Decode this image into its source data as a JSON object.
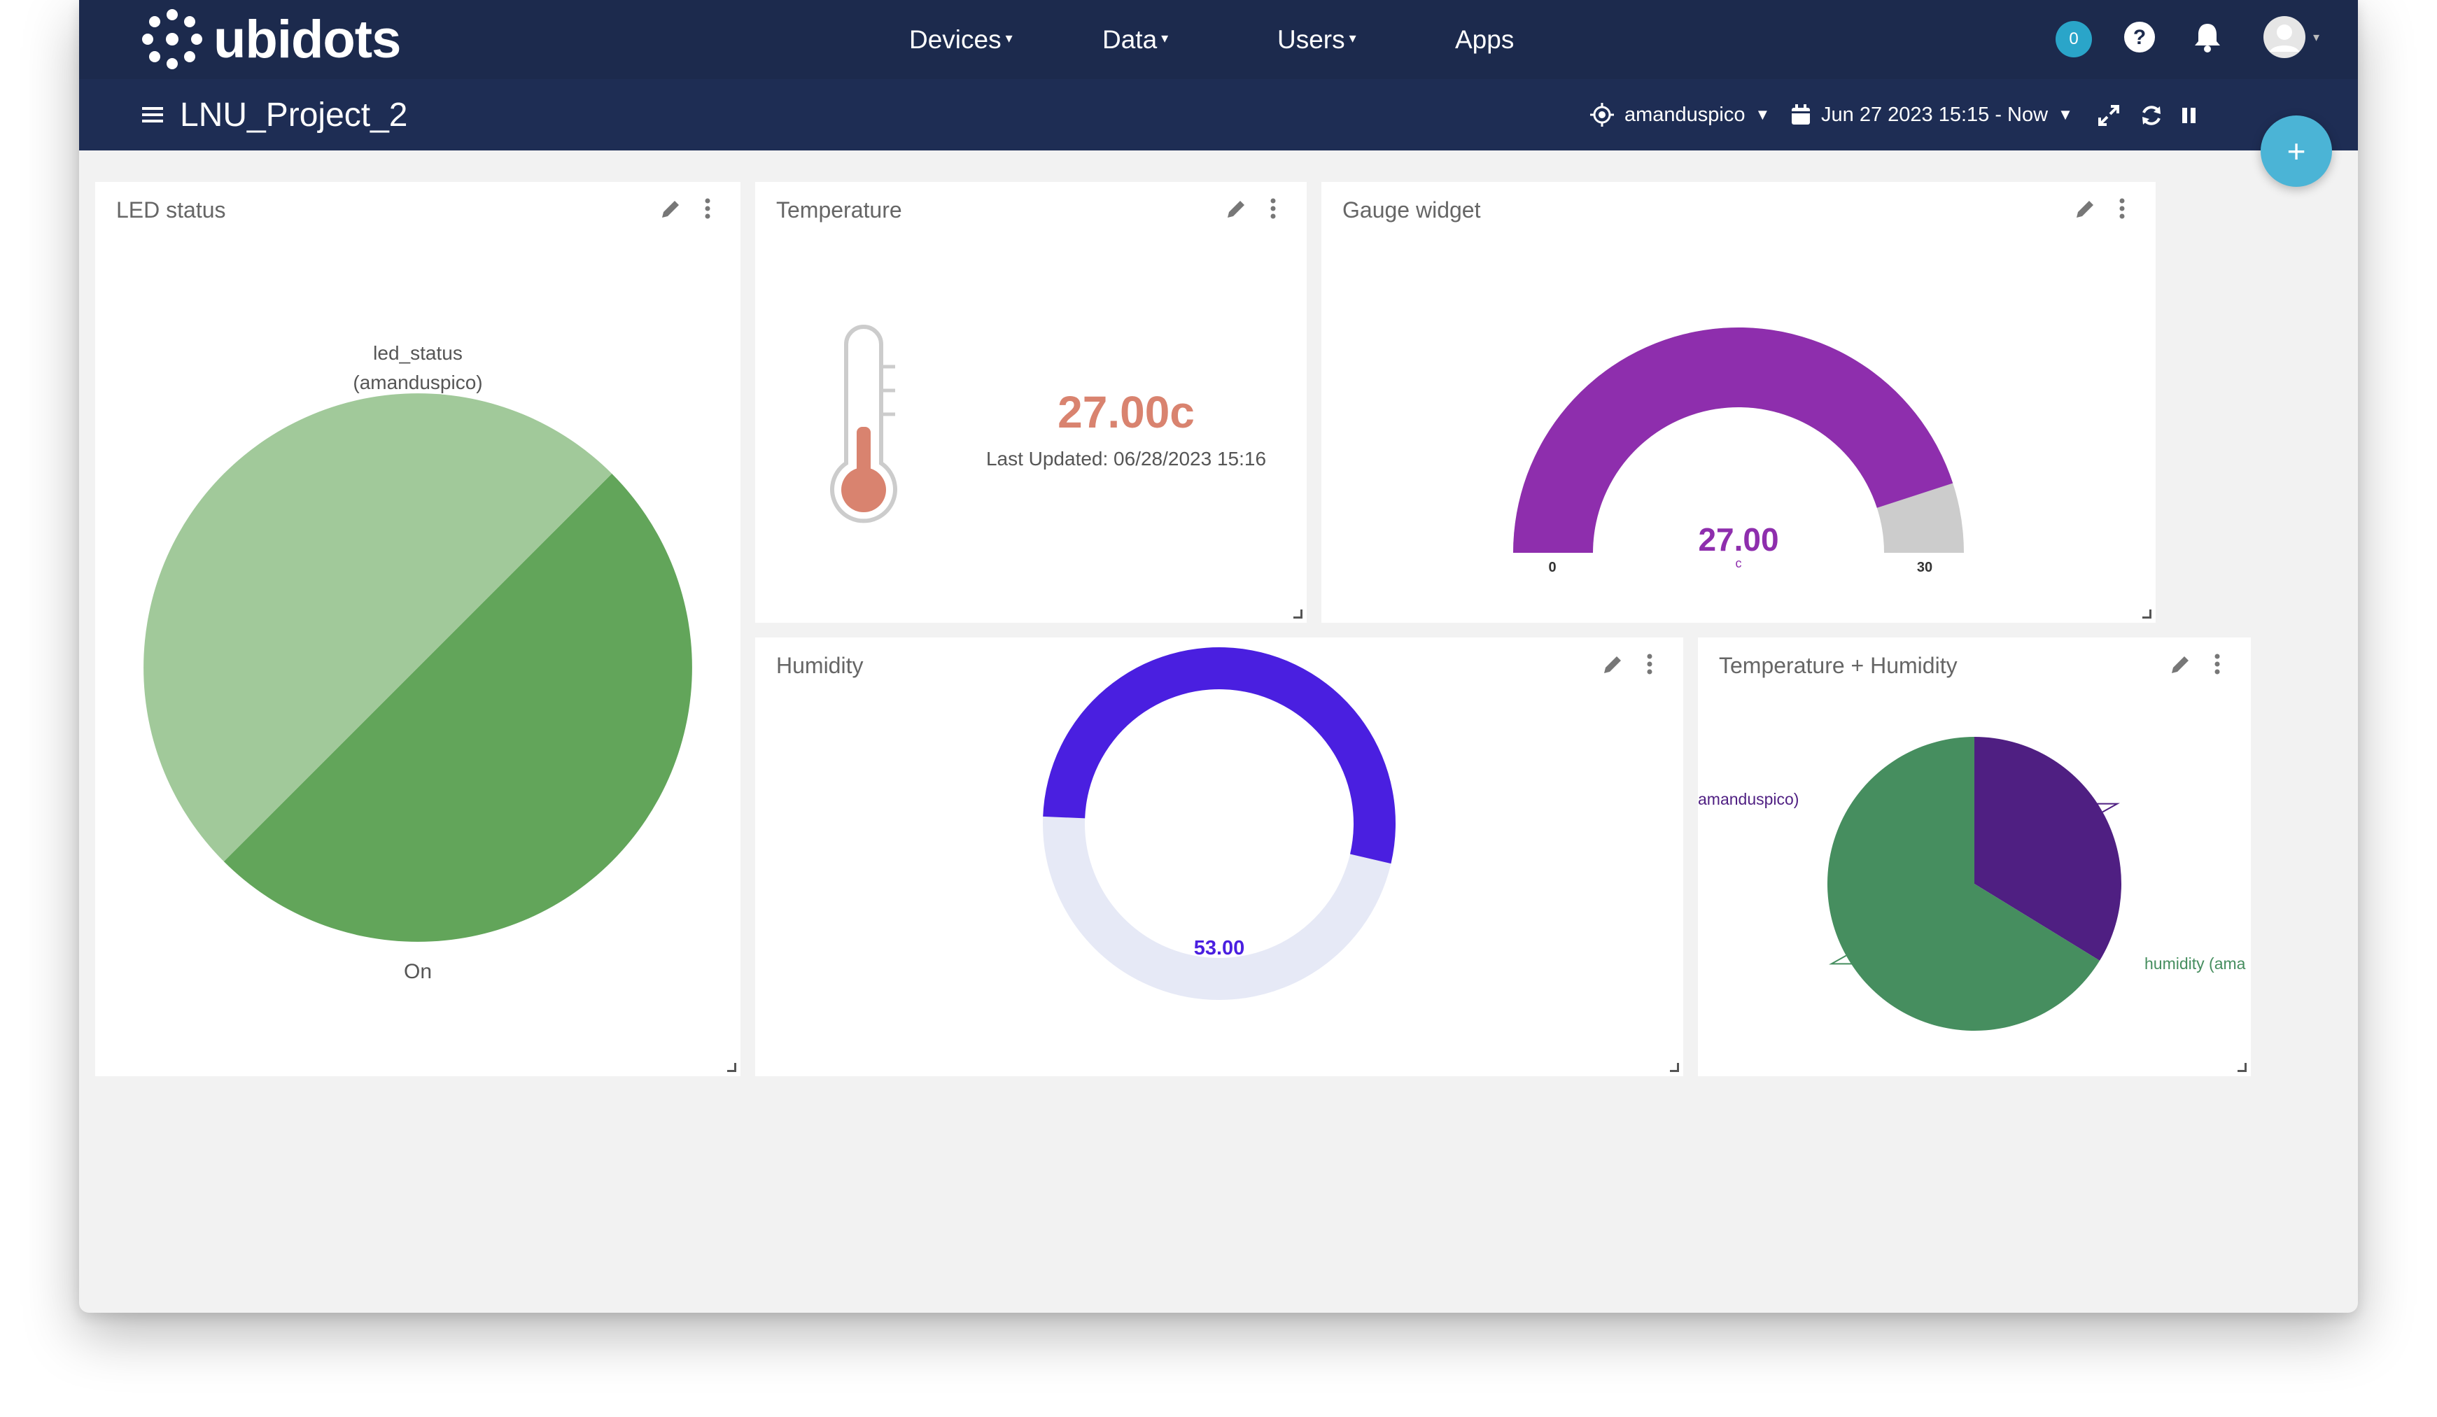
{
  "app": {
    "brand": "ubidots",
    "nav": [
      {
        "label": "Devices",
        "has_dropdown": true
      },
      {
        "label": "Data",
        "has_dropdown": true
      },
      {
        "label": "Users",
        "has_dropdown": true
      },
      {
        "label": "Apps",
        "has_dropdown": false
      }
    ],
    "notification_count": "0",
    "icons": {
      "help": "help-icon",
      "notifications": "bell-icon",
      "avatar": "user-avatar-icon"
    }
  },
  "dashboard": {
    "title": "LNU_Project_2",
    "device_filter": "amanduspico",
    "date_range": "Jun 27 2023 15:15 - Now",
    "add_button": "+"
  },
  "widgets": {
    "led": {
      "title": "LED status",
      "series_label_line1": "led_status",
      "series_label_line2": "(amanduspico)",
      "bottom_label": "On",
      "colors": [
        "#62a55a",
        "#a1c99a"
      ]
    },
    "temperature": {
      "title": "Temperature",
      "value": "27.00c",
      "last_updated": "Last Updated: 06/28/2023 15:16",
      "color": "#d9836f"
    },
    "gauge": {
      "title": "Gauge widget",
      "value": 27,
      "value_text": "27.00",
      "unit": "c",
      "min": 0,
      "max": 30,
      "min_label": "0",
      "max_label": "30",
      "color": "#8e2ead",
      "track_color": "#cccccc"
    },
    "humidity": {
      "title": "Humidity",
      "value": 53,
      "value_text": "53.00",
      "max": 100,
      "color": "#4a1fe0",
      "track_color": "#e6e9f6"
    },
    "temp_humidity": {
      "title": "Temperature + Humidity",
      "slice_left_label": "amanduspico)",
      "slice_right_label": "humidity (ama",
      "colors": [
        "#4f1f82",
        "#468e5f"
      ]
    }
  },
  "chart_data": [
    {
      "type": "pie",
      "categories": [
        "led_status (amanduspico)",
        "On"
      ],
      "values": [
        50,
        50
      ]
    },
    {
      "type": "pie",
      "categories": [
        "amanduspico)",
        "humidity (ama"
      ],
      "values": [
        33.75,
        66.25
      ]
    }
  ]
}
